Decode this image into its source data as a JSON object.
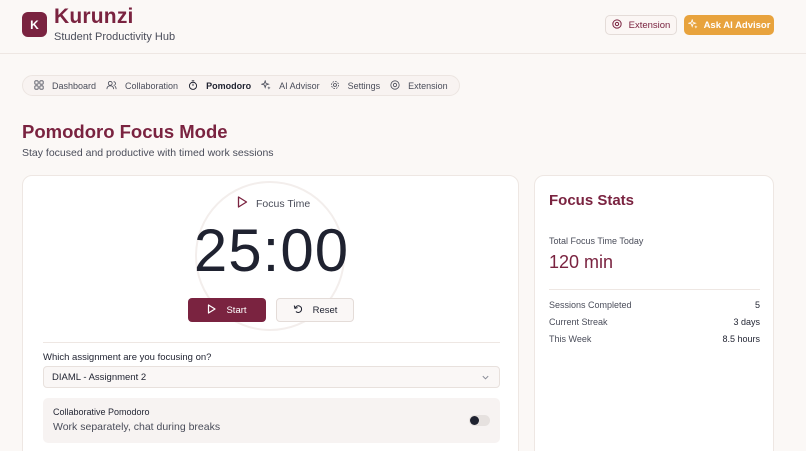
{
  "app": {
    "logo_letter": "K",
    "name": "Kurunzi",
    "tagline": "Student Productivity Hub"
  },
  "header": {
    "extension_label": "Extension",
    "ask_ai_label": "Ask AI Advisor"
  },
  "nav": {
    "items": [
      {
        "label": "Dashboard",
        "icon": "grid-icon"
      },
      {
        "label": "Collaboration",
        "icon": "users-icon"
      },
      {
        "label": "Pomodoro",
        "icon": "timer-icon",
        "active": true
      },
      {
        "label": "AI Advisor",
        "icon": "sparkles-icon"
      },
      {
        "label": "Settings",
        "icon": "gear-icon"
      },
      {
        "label": "Extension",
        "icon": "chrome-icon"
      }
    ]
  },
  "page": {
    "title": "Pomodoro Focus Mode",
    "subtitle": "Stay focused and productive with timed work sessions"
  },
  "timer": {
    "mode_label": "Focus Time",
    "time": "25:00",
    "start_label": "Start",
    "reset_label": "Reset",
    "assignment_question": "Which assignment are you focusing on?",
    "assignment_selected": "DIAML - Assignment 2",
    "collab_title": "Collaborative Pomodoro",
    "collab_desc": "Work separately, chat during breaks",
    "collab_enabled": false
  },
  "stats": {
    "title": "Focus Stats",
    "total_label": "Total Focus Time Today",
    "total_value": "120 min",
    "rows": [
      {
        "label": "Sessions Completed",
        "value": "5"
      },
      {
        "label": "Current Streak",
        "value": "3 days"
      },
      {
        "label": "This Week",
        "value": "8.5 hours"
      }
    ]
  },
  "colors": {
    "brand": "#7a2340",
    "accent": "#e8a33d",
    "background": "#fbf8f6"
  }
}
